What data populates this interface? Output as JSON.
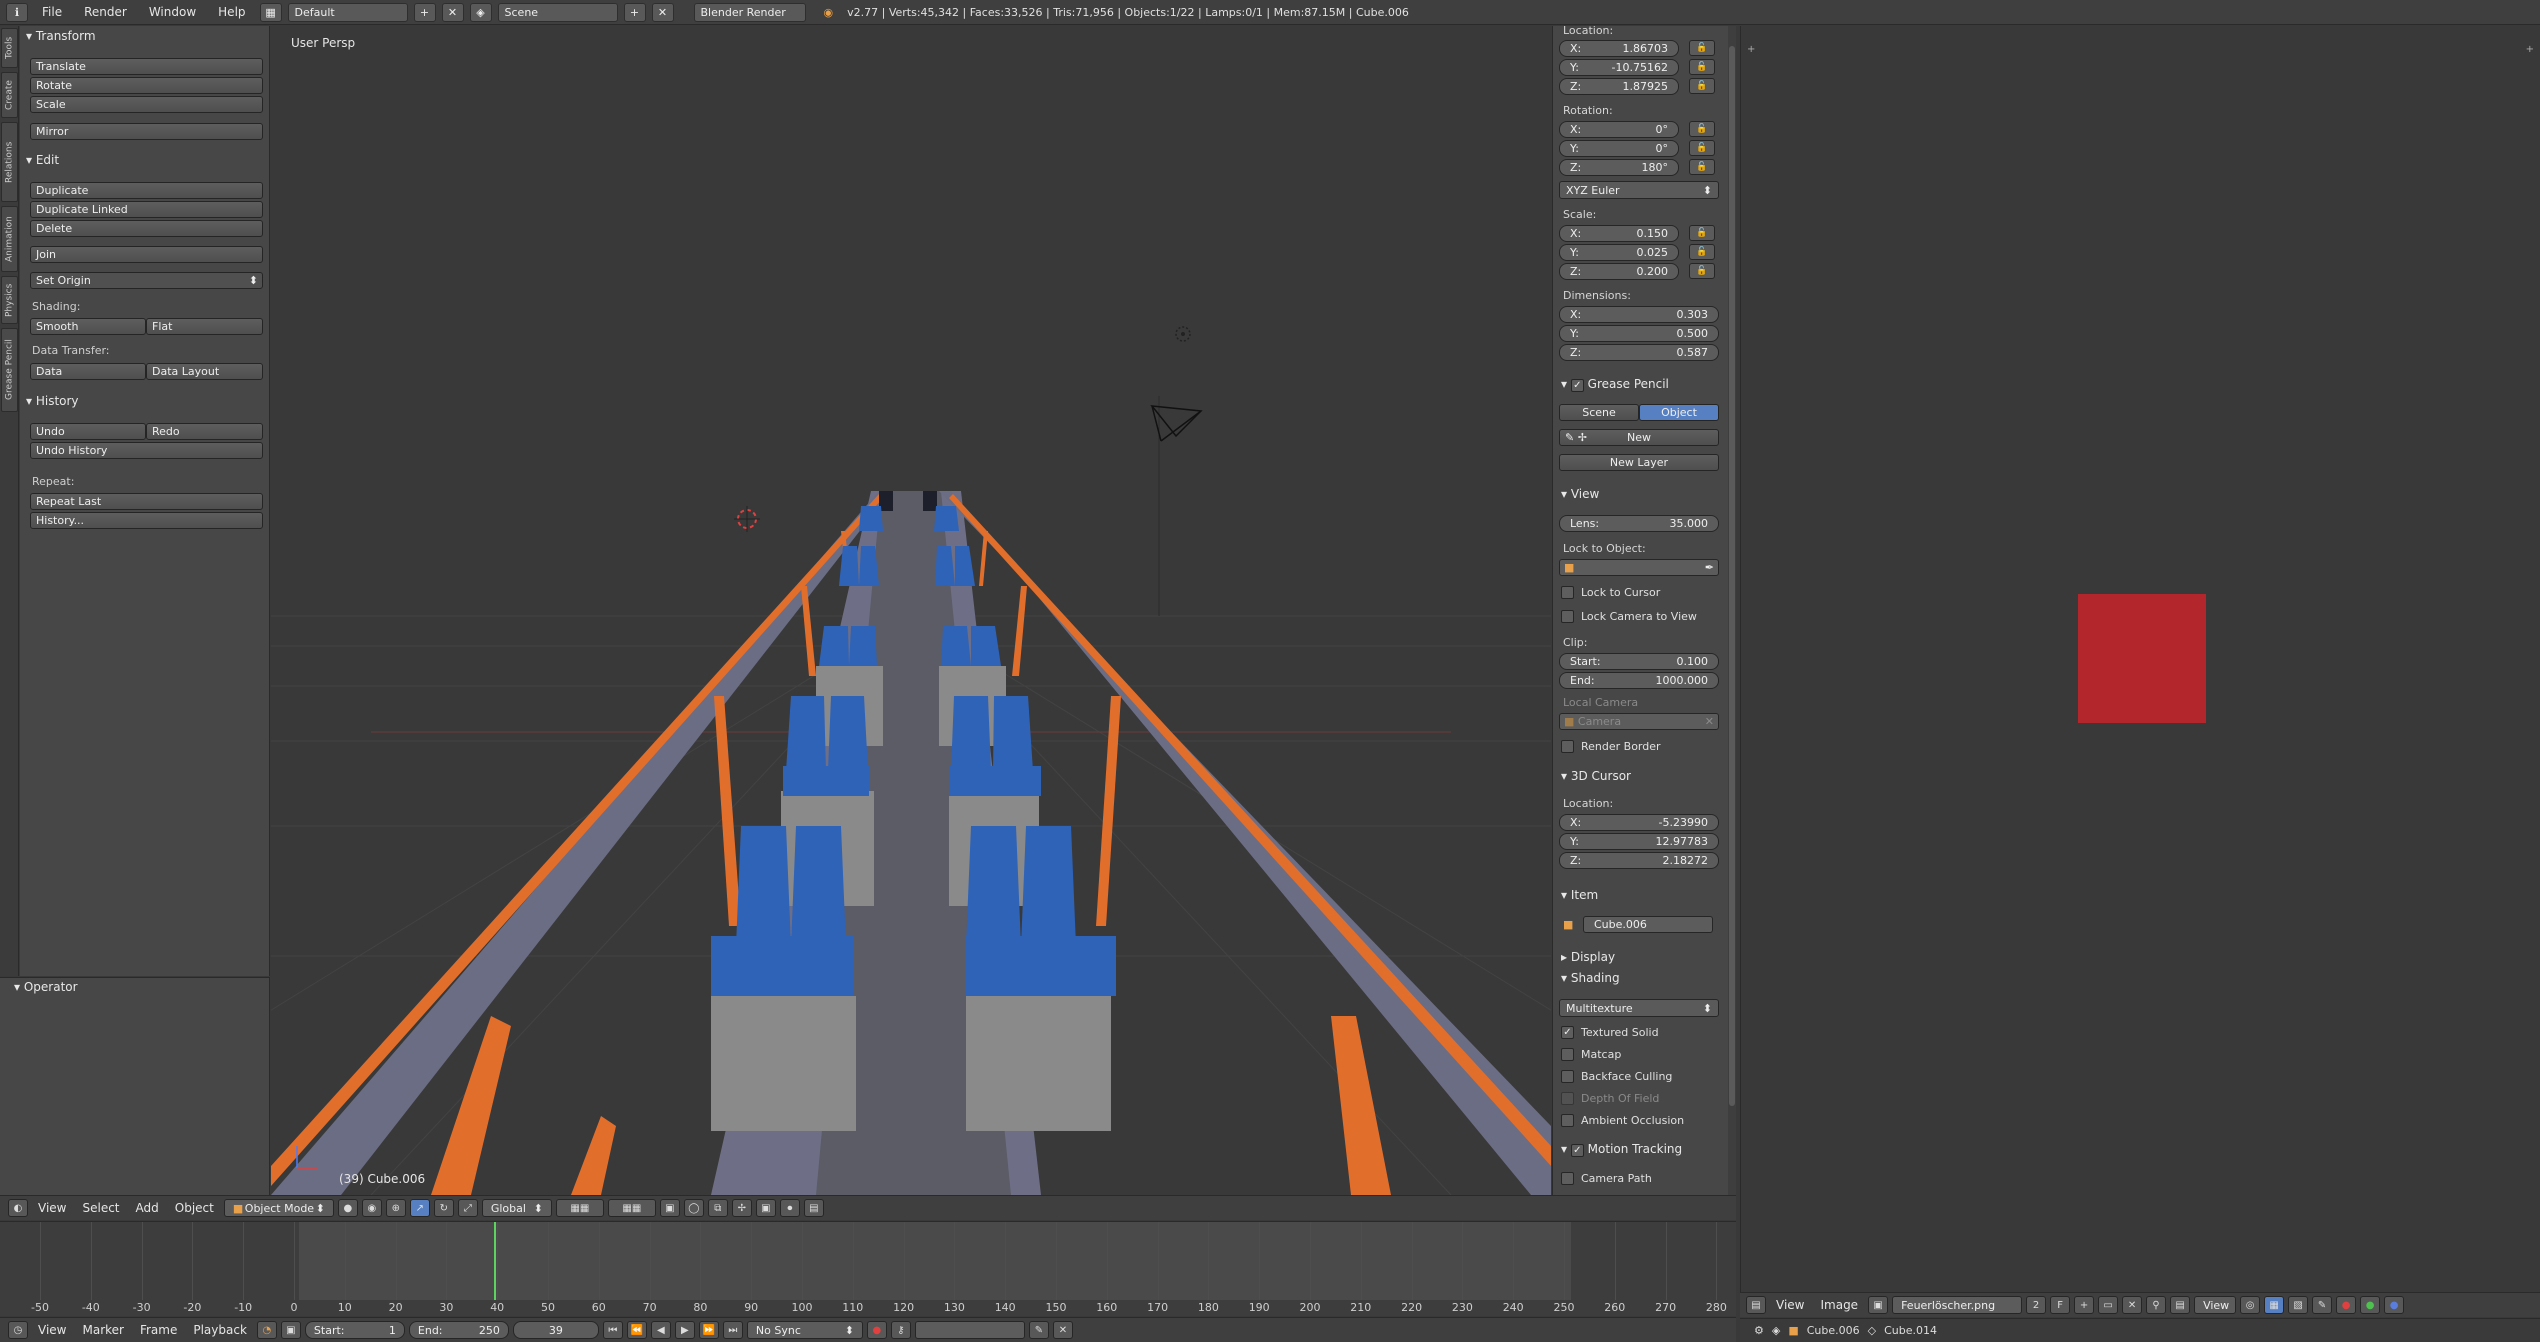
{
  "topbar": {
    "menus": [
      "File",
      "Render",
      "Window",
      "Help"
    ],
    "layout": "Default",
    "scene": "Scene",
    "engine": "Blender Render",
    "stats": "v2.77 | Verts:45,342 | Faces:33,526 | Tris:71,956 | Objects:1/22 | Lamps:0/1 | Mem:87.15M | Cube.006"
  },
  "vtabs": [
    "Tools",
    "Create",
    "Relations",
    "Animation",
    "Physics",
    "Grease Pencil"
  ],
  "toolshelf": {
    "transform": {
      "title": "Transform",
      "buttons": [
        "Translate",
        "Rotate",
        "Scale",
        "Mirror"
      ]
    },
    "edit": {
      "title": "Edit",
      "buttons": [
        "Duplicate",
        "Duplicate Linked",
        "Delete",
        "Join"
      ],
      "set_origin": "Set Origin",
      "shading_label": "Shading:",
      "smooth": "Smooth",
      "flat": "Flat",
      "data_transfer_label": "Data Transfer:",
      "data": "Data",
      "data_layout": "Data Layout"
    },
    "history": {
      "title": "History",
      "undo": "Undo",
      "redo": "Redo",
      "undo_history": "Undo History",
      "repeat_label": "Repeat:",
      "repeat_last": "Repeat Last",
      "history_btn": "History..."
    }
  },
  "operator": {
    "title": "Operator"
  },
  "viewport": {
    "label": "User Persp",
    "object_label": "(39) Cube.006"
  },
  "props": {
    "location_label": "Location:",
    "location": [
      {
        "axis": "X:",
        "value": "1.86703"
      },
      {
        "axis": "Y:",
        "value": "-10.75162"
      },
      {
        "axis": "Z:",
        "value": "1.87925"
      }
    ],
    "rotation_label": "Rotation:",
    "rotation": [
      {
        "axis": "X:",
        "value": "0°"
      },
      {
        "axis": "Y:",
        "value": "0°"
      },
      {
        "axis": "Z:",
        "value": "180°"
      }
    ],
    "rotation_mode": "XYZ Euler",
    "scale_label": "Scale:",
    "scale": [
      {
        "axis": "X:",
        "value": "0.150"
      },
      {
        "axis": "Y:",
        "value": "0.025"
      },
      {
        "axis": "Z:",
        "value": "0.200"
      }
    ],
    "dimensions_label": "Dimensions:",
    "dimensions": [
      {
        "axis": "X:",
        "value": "0.303"
      },
      {
        "axis": "Y:",
        "value": "0.500"
      },
      {
        "axis": "Z:",
        "value": "0.587"
      }
    ],
    "grease_pencil": {
      "title": "Grease Pencil",
      "scene": "Scene",
      "object": "Object",
      "new": "New",
      "new_layer": "New Layer"
    },
    "view": {
      "title": "View",
      "lens_label": "Lens:",
      "lens": "35.000",
      "lock_to_object": "Lock to Object:",
      "lock_to_cursor": "Lock to Cursor",
      "lock_camera_to_view": "Lock Camera to View",
      "clip_label": "Clip:",
      "start_label": "Start:",
      "start": "0.100",
      "end_label": "End:",
      "end": "1000.000",
      "local_camera": "Local Camera",
      "camera": "Camera",
      "render_border": "Render Border"
    },
    "cursor": {
      "title": "3D Cursor",
      "location_label": "Location:",
      "location": [
        {
          "axis": "X:",
          "value": "-5.23990"
        },
        {
          "axis": "Y:",
          "value": "12.97783"
        },
        {
          "axis": "Z:",
          "value": "2.18272"
        }
      ]
    },
    "item": {
      "title": "Item",
      "name": "Cube.006"
    },
    "display": {
      "title": "Display"
    },
    "shading": {
      "title": "Shading",
      "mode": "Multitexture",
      "textured_solid": "Textured Solid",
      "matcap": "Matcap",
      "backface_culling": "Backface Culling",
      "depth_of_field": "Depth Of Field",
      "ambient_occlusion": "Ambient Occlusion"
    },
    "motion_tracking": {
      "title": "Motion Tracking",
      "camera_path": "Camera Path"
    }
  },
  "view3d_header": {
    "menus": [
      "View",
      "Select",
      "Add",
      "Object"
    ],
    "mode": "Object Mode",
    "orientation": "Global"
  },
  "timeline": {
    "ticks": [
      "-50",
      "-40",
      "-30",
      "-20",
      "-10",
      "0",
      "10",
      "20",
      "30",
      "40",
      "50",
      "60",
      "70",
      "80",
      "90",
      "100",
      "110",
      "120",
      "130",
      "140",
      "150",
      "160",
      "170",
      "180",
      "190",
      "200",
      "210",
      "220",
      "230",
      "240",
      "250",
      "260",
      "270",
      "280"
    ],
    "menus": [
      "View",
      "Marker",
      "Frame",
      "Playback"
    ],
    "start_label": "Start:",
    "start": "1",
    "end_label": "End:",
    "end": "250",
    "current": "39",
    "sync": "No Sync"
  },
  "image_editor": {
    "menus": [
      "View",
      "Image"
    ],
    "image_name": "Feuerlöscher.png",
    "users": "2",
    "fake": "F",
    "view_menu": "View",
    "status_obj": "Cube.006",
    "status_mat": "Cube.014"
  },
  "colors": {
    "accent": "#5680c2",
    "image_fill": "#b3262b",
    "rail": "#e26e2c",
    "seat": "#2f63b8"
  }
}
